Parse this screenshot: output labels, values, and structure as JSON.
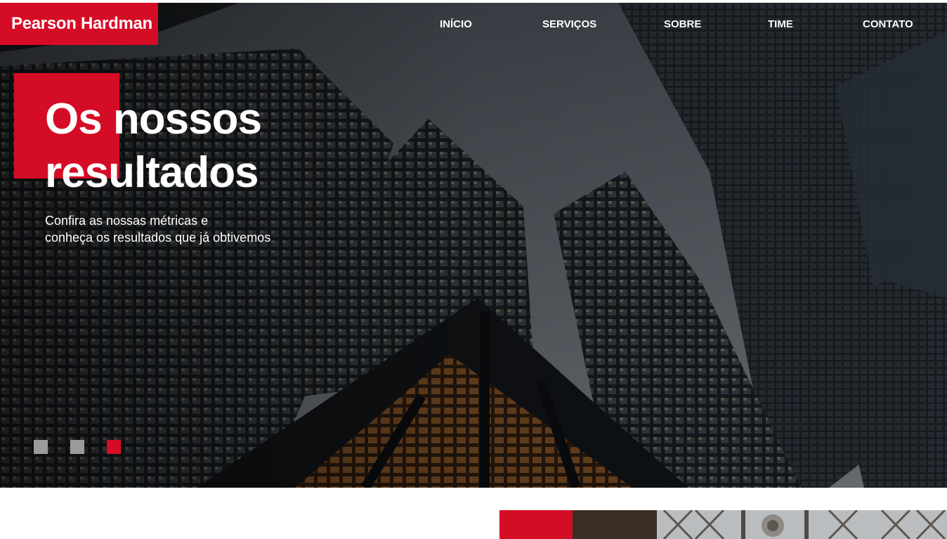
{
  "brand": {
    "name": "Pearson Hardman",
    "accent": "#d50c25"
  },
  "nav": {
    "items": [
      {
        "label": "INÍCIO"
      },
      {
        "label": "SERVIÇOS"
      },
      {
        "label": "SOBRE"
      },
      {
        "label": "TIME"
      },
      {
        "label": "CONTATO"
      }
    ]
  },
  "hero": {
    "title_line1": "Os nossos",
    "title_line2": "resultados",
    "subtitle_line1": "Confira as nossas métricas e",
    "subtitle_line2": "conheça os resultados que já obtivemos",
    "slides": {
      "count": 3,
      "active_index": 2
    }
  },
  "colors": {
    "dot_inactive": "#9b9b9b",
    "dot_active": "#d50c25"
  }
}
